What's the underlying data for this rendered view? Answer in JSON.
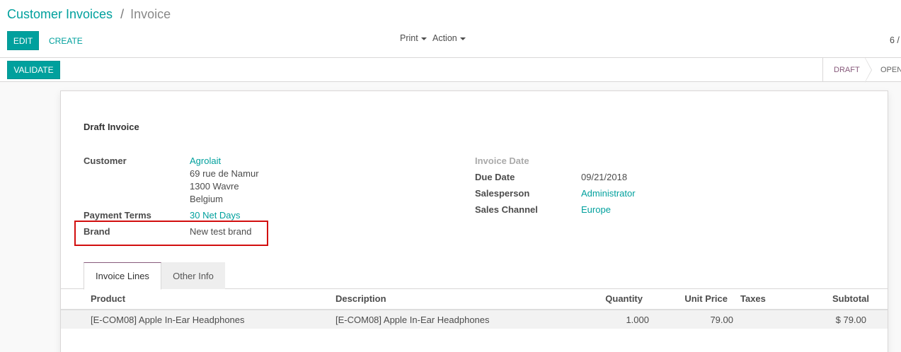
{
  "breadcrumb": {
    "parent": "Customer Invoices",
    "separator": "/",
    "current": "Invoice"
  },
  "toolbar": {
    "edit_label": "EDIT",
    "create_label": "CREATE",
    "print_label": "Print",
    "action_label": "Action",
    "pager": "6 /"
  },
  "statusbar": {
    "validate_label": "VALIDATE",
    "steps": [
      "DRAFT",
      "OPEN"
    ],
    "active_step": "DRAFT"
  },
  "form": {
    "title": "Draft Invoice",
    "customer_label": "Customer",
    "customer_name": "Agrolait",
    "address_line1": "69 rue de Namur",
    "address_line2": "1300 Wavre",
    "address_line3": "Belgium",
    "payment_terms_label": "Payment Terms",
    "payment_terms_value": "30 Net Days",
    "brand_label": "Brand",
    "brand_value": "New test brand",
    "invoice_date_label": "Invoice Date",
    "due_date_label": "Due Date",
    "due_date_value": "09/21/2018",
    "salesperson_label": "Salesperson",
    "salesperson_value": "Administrator",
    "sales_channel_label": "Sales Channel",
    "sales_channel_value": "Europe"
  },
  "tabs": [
    "Invoice Lines",
    "Other Info"
  ],
  "table": {
    "headers": [
      "Product",
      "Description",
      "Quantity",
      "Unit Price",
      "Taxes",
      "Subtotal"
    ],
    "rows": [
      {
        "product": "[E-COM08] Apple In-Ear Headphones",
        "description": "[E-COM08] Apple In-Ear Headphones",
        "quantity": "1.000",
        "unit_price": "79.00",
        "taxes": "",
        "subtotal": "$ 79.00"
      }
    ]
  },
  "colors": {
    "accent": "#00a09d",
    "status_active": "#875a7b",
    "highlight": "#d20e0e"
  }
}
